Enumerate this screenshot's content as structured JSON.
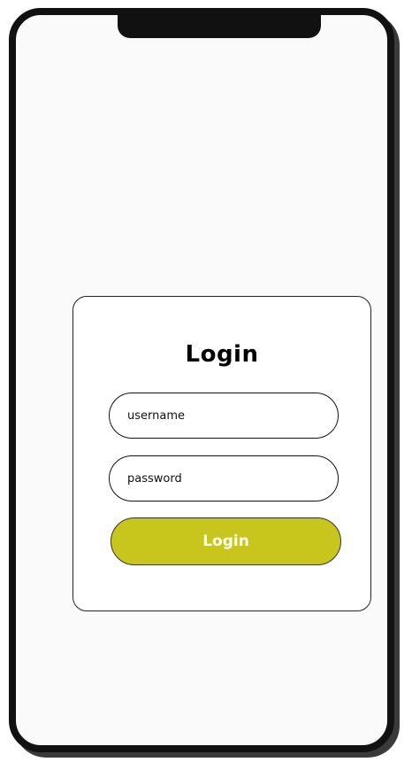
{
  "login_form": {
    "title": "Login",
    "username_placeholder": "username",
    "password_placeholder": "password",
    "submit_label": "Login"
  },
  "colors": {
    "accent": "#c8c51c",
    "frame": "#111111",
    "background": "#fafafa"
  }
}
